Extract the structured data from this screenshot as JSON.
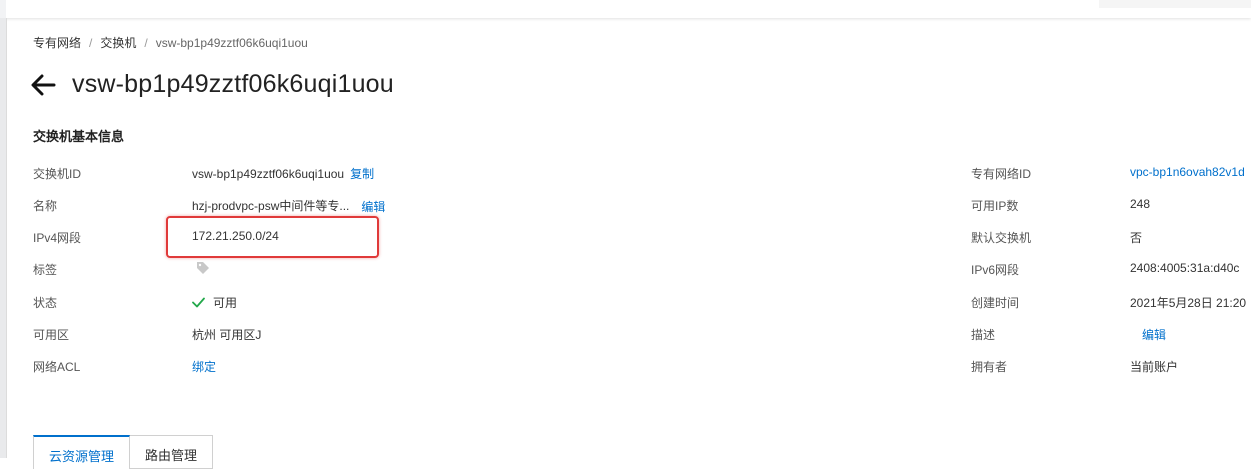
{
  "breadcrumb": {
    "item1": "专有网络",
    "sep": "/",
    "item2": "交换机",
    "current": "vsw-bp1p49zztf06k6uqi1uou"
  },
  "page": {
    "title": "vsw-bp1p49zztf06k6uqi1uou"
  },
  "section": {
    "title": "交换机基本信息"
  },
  "left": {
    "vsw_id": {
      "label": "交换机ID",
      "value": "vsw-bp1p49zztf06k6uqi1uou",
      "action": "复制"
    },
    "name": {
      "label": "名称",
      "value": "hzj-prodvpc-psw中间件等专...",
      "action": "编辑"
    },
    "ipv4": {
      "label": "IPv4网段",
      "value": "172.21.250.0/24"
    },
    "tags": {
      "label": "标签"
    },
    "status": {
      "label": "状态",
      "value": "可用"
    },
    "zone": {
      "label": "可用区",
      "value": "杭州 可用区J"
    },
    "acl": {
      "label": "网络ACL",
      "action": "绑定"
    }
  },
  "right": {
    "vpc_id": {
      "label": "专有网络ID",
      "value": "vpc-bp1n6ovah82v1d"
    },
    "available_ips": {
      "label": "可用IP数",
      "value": "248"
    },
    "default_vsw": {
      "label": "默认交换机",
      "value": "否"
    },
    "ipv6": {
      "label": "IPv6网段",
      "value": "2408:4005:31a:d40c"
    },
    "created": {
      "label": "创建时间",
      "value": "2021年5月28日 21:20"
    },
    "desc": {
      "label": "描述",
      "action": "编辑"
    },
    "owner": {
      "label": "拥有者",
      "value": "当前账户"
    }
  },
  "tabs": [
    {
      "label": "云资源管理"
    },
    {
      "label": "路由管理"
    }
  ],
  "icons": {
    "back": "arrow-left-icon",
    "tag": "tag-icon",
    "check": "check-icon"
  },
  "colors": {
    "link": "#0070cc",
    "highlight": "#e03a3a",
    "success": "#22a84a"
  }
}
